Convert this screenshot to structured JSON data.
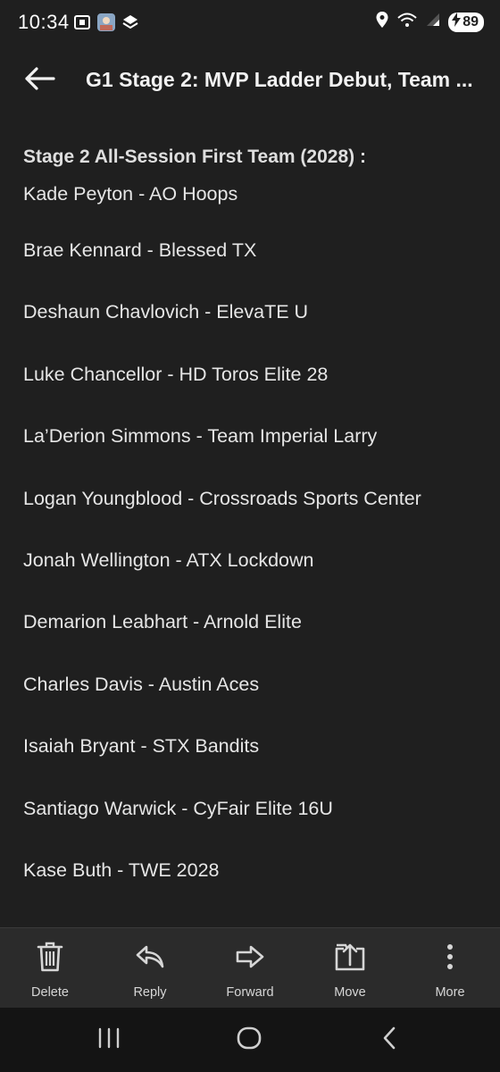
{
  "status_bar": {
    "time": "10:34",
    "battery": "89"
  },
  "app_bar": {
    "title": "G1 Stage 2: MVP Ladder Debut, Team ..."
  },
  "message": {
    "heading": "Stage 2 All-Session First Team (2028) :",
    "players": [
      "Kade Peyton - AO Hoops",
      "Brae Kennard - Blessed TX",
      "Deshaun Chavlovich - ElevaTE U",
      "Luke Chancellor - HD Toros Elite 28",
      "La’Derion Simmons - Team Imperial Larry",
      "Logan Youngblood - Crossroads Sports Center",
      "Jonah Wellington - ATX Lockdown",
      "Demarion Leabhart - Arnold Elite",
      "Charles Davis - Austin Aces",
      "Isaiah Bryant - STX Bandits",
      "Santiago Warwick - CyFair Elite 16U",
      "Kase Buth - TWE 2028"
    ]
  },
  "action_bar": {
    "delete": "Delete",
    "reply": "Reply",
    "forward": "Forward",
    "move": "Move",
    "more": "More"
  },
  "icons": {
    "back": "arrow-left-icon",
    "delete": "trash-icon",
    "reply": "reply-icon",
    "forward": "forward-icon",
    "move": "move-icon",
    "more": "more-vertical-icon"
  },
  "colors": {
    "background": "#1f1f1f",
    "action_bar": "#2b2b2b",
    "nav_bar": "#141414",
    "text": "#e6e6e6"
  }
}
